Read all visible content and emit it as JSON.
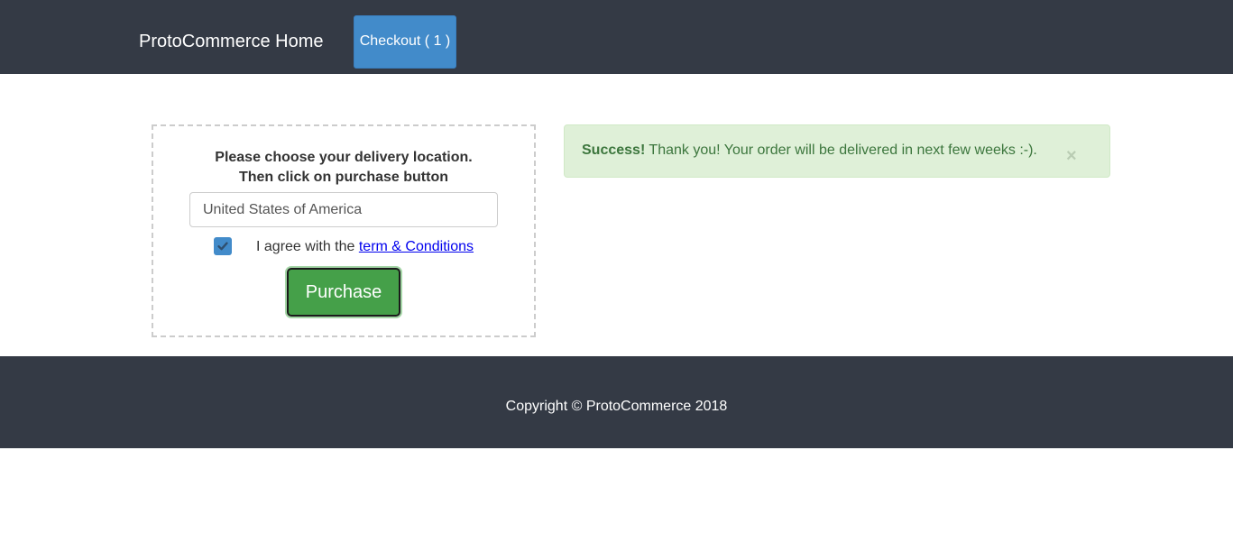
{
  "navbar": {
    "brand": "ProtoCommerce Home",
    "checkout_label": "Checkout ( 1 )"
  },
  "delivery": {
    "instruction_line1": "Please choose your delivery location.",
    "instruction_line2": "Then click on purchase button",
    "country_value": "United States of America",
    "agree_checked": true,
    "agree_prefix": "I agree with the ",
    "terms_link": "term & Conditions",
    "purchase_label": "Purchase"
  },
  "alert": {
    "strong": "Success!",
    "message": " Thank you! Your order will be delivered in next few weeks :-).",
    "close_symbol": "×"
  },
  "footer": {
    "copyright": "Copyright © ProtoCommerce 2018"
  },
  "colors": {
    "navbar_bg": "#343a45",
    "checkout_btn": "#428bca",
    "purchase_btn": "#45a049",
    "alert_bg": "#dff0d8",
    "alert_text": "#3c763d",
    "link": "#0000ee"
  }
}
